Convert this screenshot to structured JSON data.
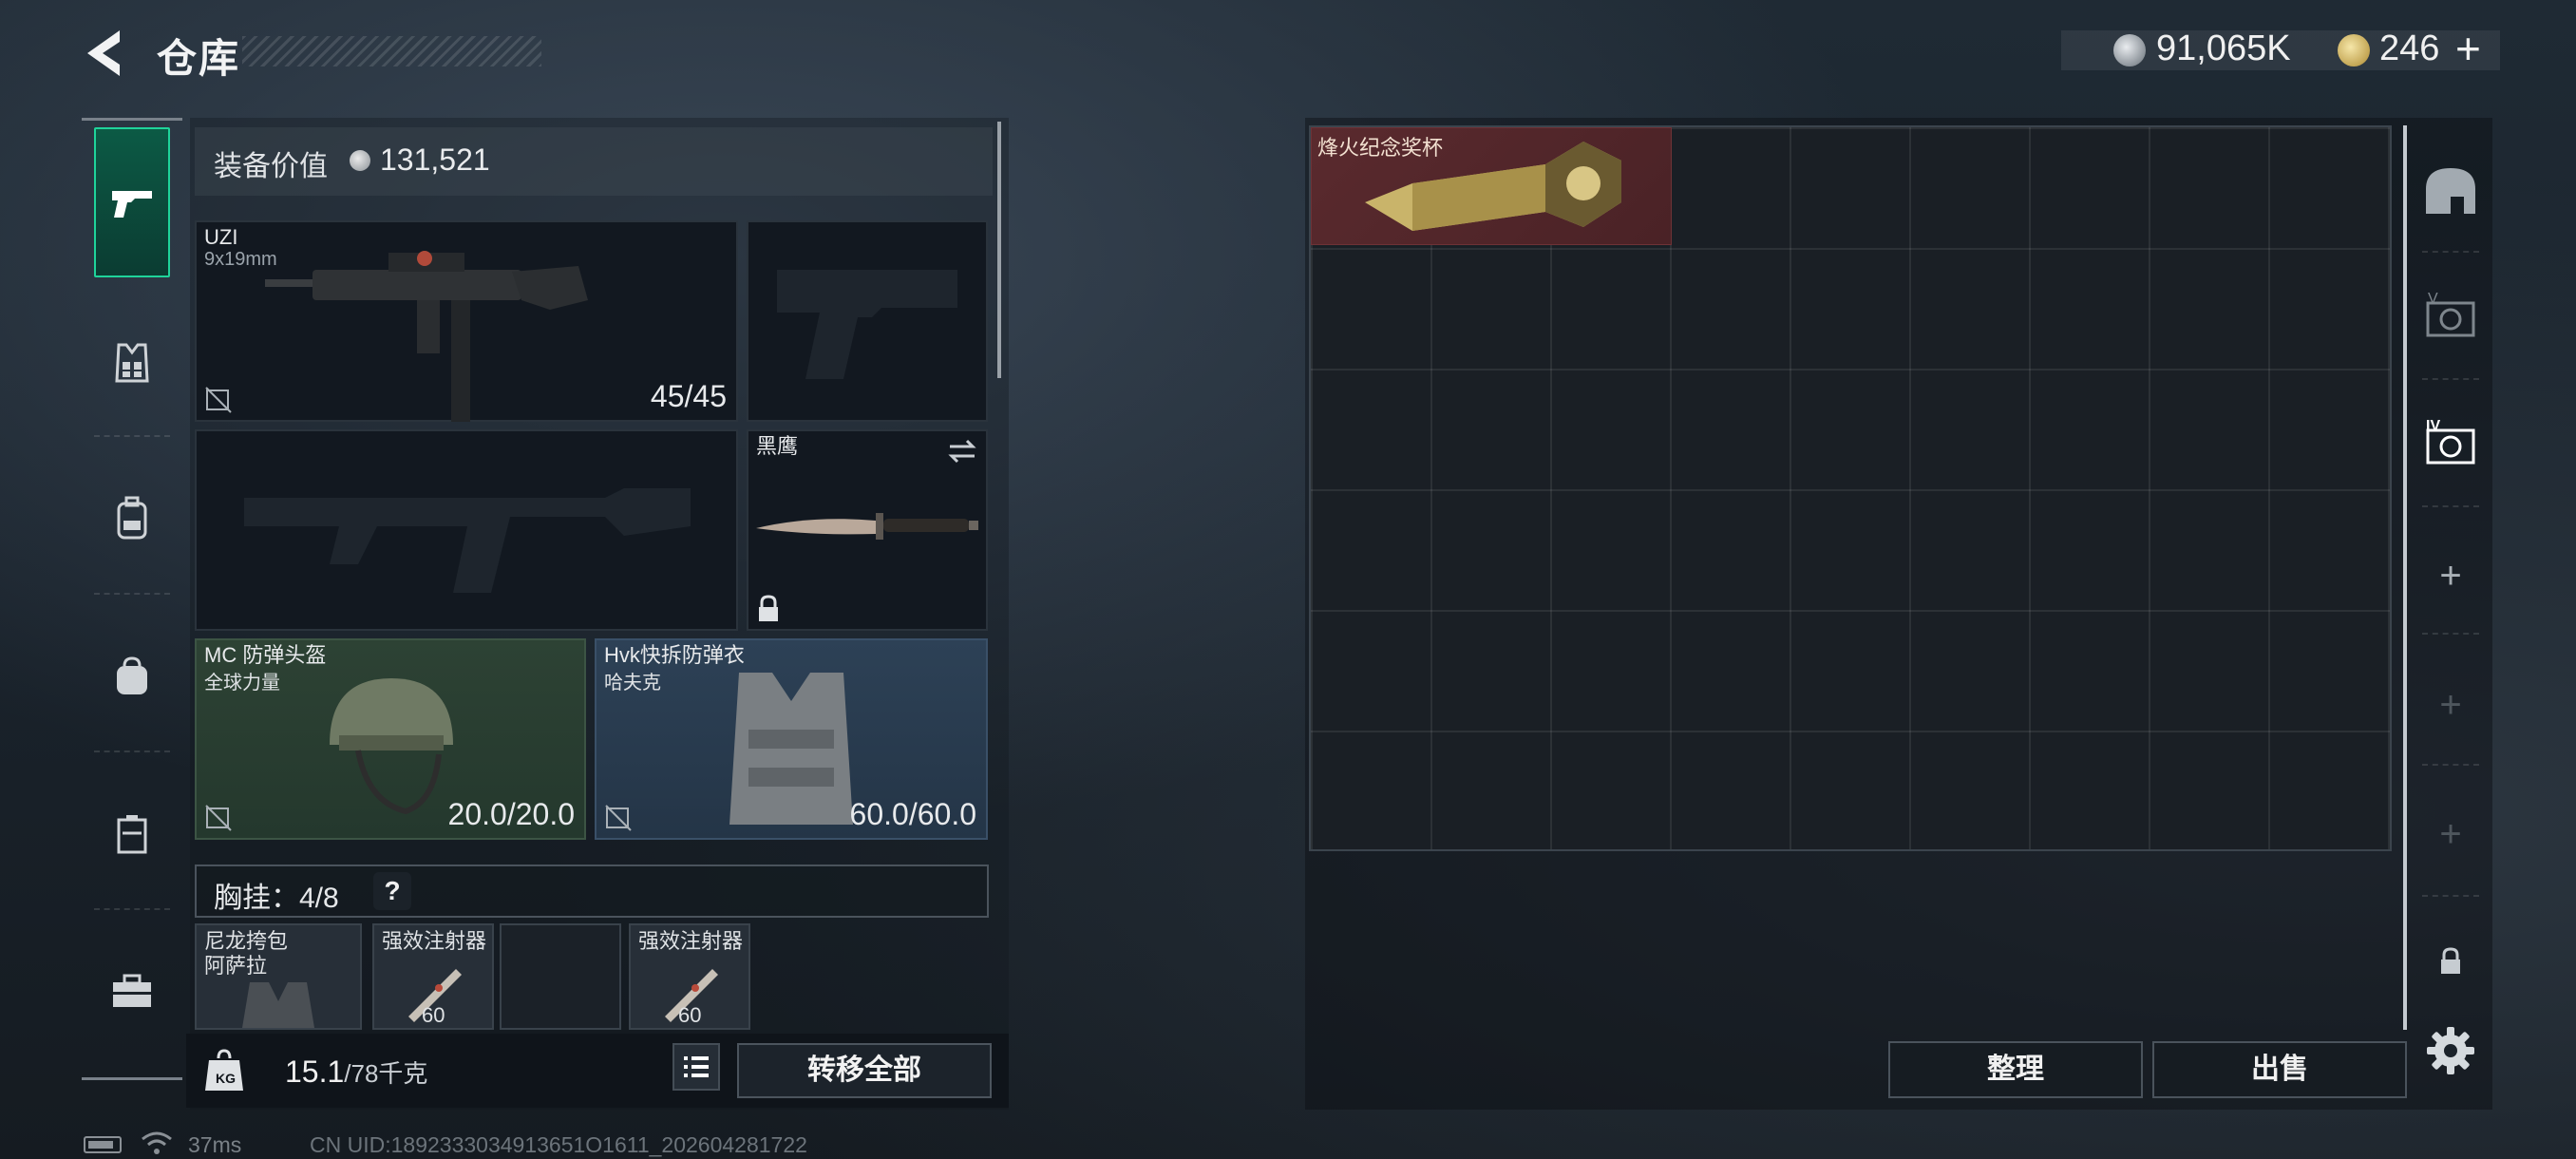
{
  "header": {
    "title": "仓库",
    "currency_primary": "91,065K",
    "currency_secondary": "246"
  },
  "loadout": {
    "equipment_value_label": "装备价值",
    "equipment_value": "131,521",
    "primary_weapon": {
      "name": "UZI",
      "ammo_type": "9x19mm",
      "ammo": "45/45"
    },
    "melee": {
      "name": "黑鹰"
    },
    "helmet": {
      "name": "MC 防弹头盔",
      "brand": "全球力量",
      "durability": "20.0/20.0"
    },
    "armor": {
      "name": "Hvk快拆防弹衣",
      "brand": "哈夫克",
      "durability": "60.0/60.0"
    },
    "chest_rig": {
      "label": "胸挂：",
      "capacity": "4/8",
      "help": "?"
    },
    "pouches": [
      {
        "name": "尼龙挎包",
        "sub": "阿萨拉"
      },
      {
        "name": "强效注射器",
        "count": "60"
      },
      {
        "name": ""
      },
      {
        "name": "强效注射器",
        "count": "60"
      }
    ],
    "weight_current": "15.1",
    "weight_max": "/78千克",
    "transfer_all": "转移全部"
  },
  "stash": {
    "items": [
      {
        "name": "烽火纪念奖杯"
      }
    ],
    "sort_button": "整理",
    "sell_button": "出售"
  },
  "status": {
    "ping": "37ms",
    "uid": "CN UID:1892333034913651O1611_202604281722"
  },
  "colors": {
    "nav_active": "#0c5a45",
    "nav_active_border": "#1fd49a",
    "helmet_slot": "#2d4234",
    "armor_slot": "#2d4156",
    "trophy_slot": "#5a2a2e"
  }
}
